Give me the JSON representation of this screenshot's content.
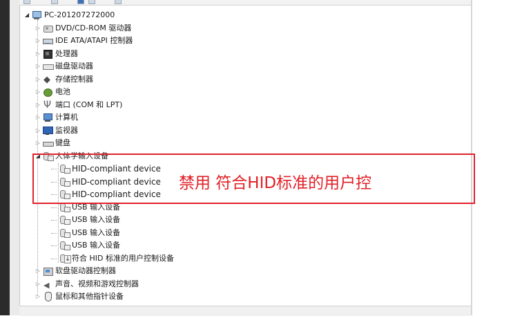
{
  "device_tree": {
    "root": {
      "label": "PC-201207272000",
      "icon": "computer-icon",
      "expanded": true
    },
    "categories_top": [
      {
        "label": "DVD/CD-ROM 驱动器",
        "icon": "dvd-drive-icon"
      },
      {
        "label": "IDE ATA/ATAPI 控制器",
        "icon": "ide-controller-icon"
      },
      {
        "label": "处理器",
        "icon": "processor-icon"
      },
      {
        "label": "磁盘驱动器",
        "icon": "disk-drive-icon"
      },
      {
        "label": "存储控制器",
        "icon": "storage-controller-icon"
      },
      {
        "label": "电池",
        "icon": "battery-icon"
      },
      {
        "label": "端口 (COM 和 LPT)",
        "icon": "port-icon"
      },
      {
        "label": "计算机",
        "icon": "computer-icon"
      },
      {
        "label": "监视器",
        "icon": "monitor-icon"
      },
      {
        "label": "键盘",
        "icon": "keyboard-icon"
      }
    ],
    "hid_category": {
      "label": "人体学输入设备",
      "icon": "hid-icon",
      "expanded": true,
      "children": [
        {
          "label": "HID-compliant device",
          "icon": "hid-device-icon"
        },
        {
          "label": "HID-compliant device",
          "icon": "hid-device-icon"
        },
        {
          "label": "HID-compliant device",
          "icon": "hid-device-icon"
        },
        {
          "label": "USB 输入设备",
          "icon": "usb-input-icon"
        },
        {
          "label": "USB 输入设备",
          "icon": "usb-input-icon"
        },
        {
          "label": "USB 输入设备",
          "icon": "usb-input-icon"
        },
        {
          "label": "USB 输入设备",
          "icon": "usb-input-icon"
        },
        {
          "label": "符合 HID 标准的用户控制设备",
          "icon": "hid-control-disabled-icon"
        }
      ]
    },
    "categories_bottom": [
      {
        "label": "软盘驱动器控制器",
        "icon": "floppy-controller-icon"
      },
      {
        "label": "声音、视频和游戏控制器",
        "icon": "sound-icon"
      },
      {
        "label": "鼠标和其他指针设备",
        "icon": "mouse-icon"
      }
    ]
  },
  "annotation": {
    "text": "禁用 符合HID标准的用户控",
    "color": "#e21f26"
  }
}
